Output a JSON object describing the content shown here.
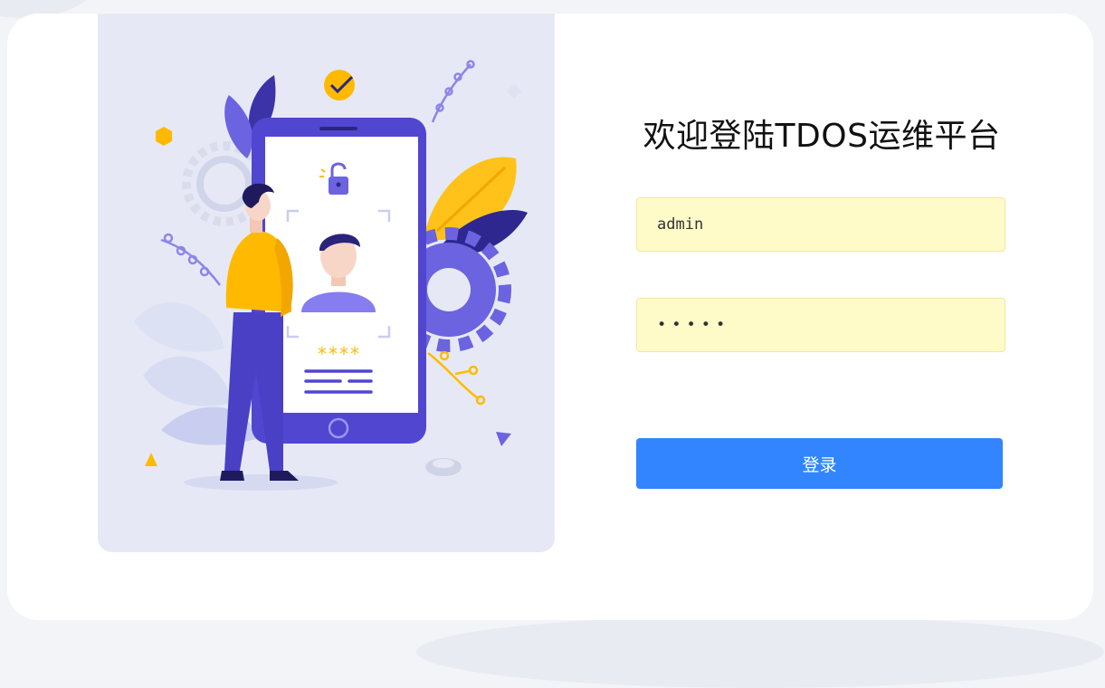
{
  "login": {
    "title": "欢迎登陆TDOS运维平台",
    "username_value": "admin",
    "password_value": "•••••",
    "submit_label": "登录"
  },
  "illustration": {
    "masked_pin": "****"
  },
  "colors": {
    "background": "#f3f4f8",
    "card": "#ffffff",
    "illustration_panel": "#e6e9f5",
    "input_autofill": "#fffbc8",
    "primary_button": "#3285fe",
    "phone_purple": "#5146d0",
    "accent_yellow": "#ffba00"
  },
  "icons": [
    "padlock-icon",
    "check-badge-icon",
    "gear-icon",
    "person-avatar-icon"
  ]
}
